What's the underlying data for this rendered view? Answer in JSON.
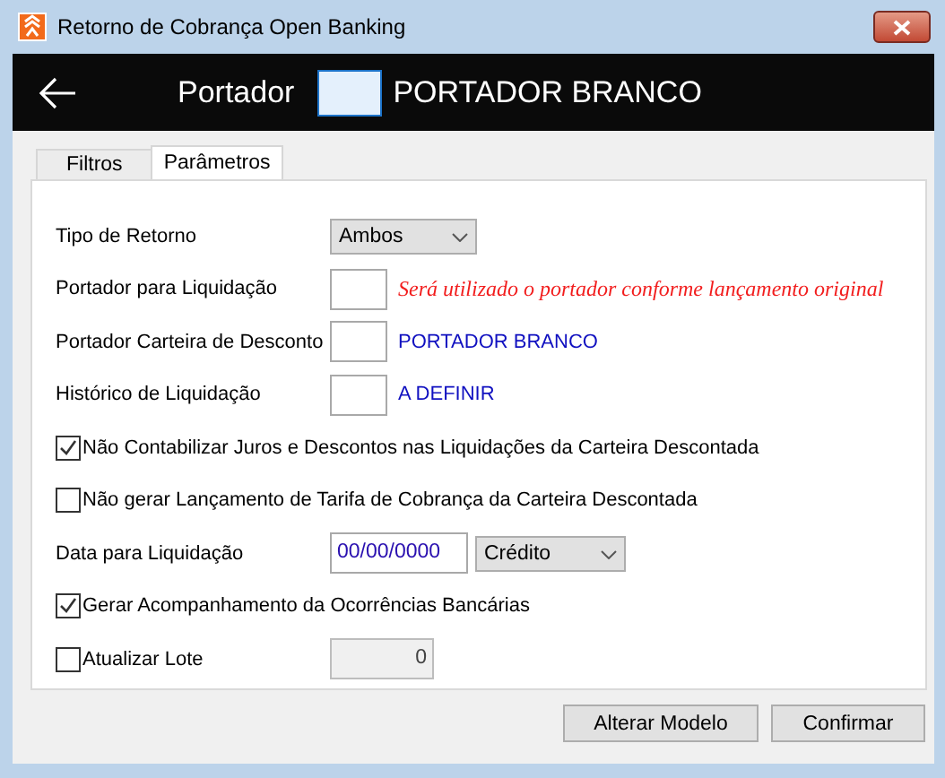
{
  "window": {
    "title": "Retorno de Cobrança Open Banking"
  },
  "header": {
    "label": "Portador",
    "name": "PORTADOR BRANCO"
  },
  "tabs": [
    {
      "label": "Filtros",
      "selected": false
    },
    {
      "label": "Parâmetros",
      "selected": true
    }
  ],
  "fields": [
    {
      "kind": "select",
      "label": "Tipo de Retorno",
      "value": "Ambos"
    },
    {
      "kind": "code",
      "label": "Portador para Liquidação",
      "note": "Será utilizado o portador conforme lançamento original",
      "color": "#f21d1d"
    },
    {
      "kind": "code",
      "label": "Portador Carteira de Desconto",
      "note": "PORTADOR BRANCO",
      "color": "#1010c0"
    },
    {
      "kind": "code",
      "label": "Histórico de Liquidação",
      "note": "A DEFINIR",
      "color": "#1010c0"
    },
    {
      "kind": "check",
      "label": "Não Contabilizar Juros e Descontos nas Liquidações da Carteira Descontada",
      "checked": true
    },
    {
      "kind": "check",
      "label": "Não gerar Lançamento de Tarifa de Cobrança da Carteira Descontada",
      "checked": false
    },
    {
      "kind": "date",
      "label": "Data para Liquidação",
      "value": "00/00/0000",
      "option": "Crédito"
    },
    {
      "kind": "check",
      "label": "Gerar Acompanhamento da Ocorrências Bancárias",
      "checked": true
    },
    {
      "kind": "check_number",
      "label": "Atualizar Lote",
      "checked": false,
      "value": "0",
      "disabled": true
    }
  ],
  "buttons": [
    "Alterar Modelo",
    "Confirmar"
  ]
}
